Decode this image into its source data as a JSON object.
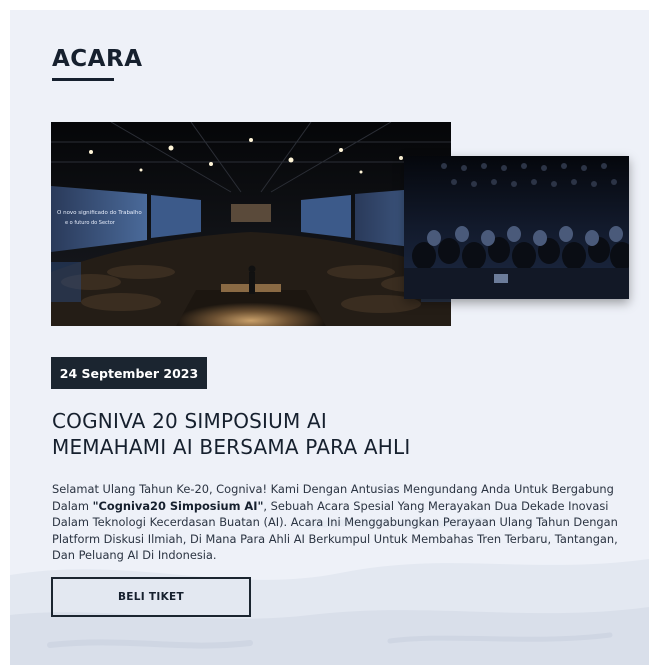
{
  "section": {
    "title": "ACARA"
  },
  "images": {
    "main": {
      "screen_left": "O novo significado do Trabalho",
      "screen_left_sub": "e o futuro do Sector"
    }
  },
  "event": {
    "date": "24 September 2023",
    "title_line1": "COGNIVA 20 SIMPOSIUM AI",
    "title_line2": "MEMAHAMI AI BERSAMA PARA AHLI",
    "description_before": "Selamat Ulang Tahun Ke-20, Cogniva! Kami Dengan Antusias Mengundang Anda Untuk Bergabung Dalam ",
    "description_bold": "\"Cogniva20 Simposium AI\"",
    "description_after": ", Sebuah Acara Spesial Yang Merayakan Dua Dekade Inovasi Dalam Teknologi Kecerdasan Buatan (AI). Acara Ini Menggabungkan Perayaan Ulang Tahun Dengan Platform Diskusi Ilmiah, Di Mana Para Ahli AI Berkumpul Untuk Membahas Tren Terbaru, Tantangan, Dan Peluang AI Di Indonesia.",
    "button_label": "BELI TIKET"
  },
  "colors": {
    "background": "#eef1f8",
    "dark": "#1b2530",
    "text": "#2b3442"
  }
}
